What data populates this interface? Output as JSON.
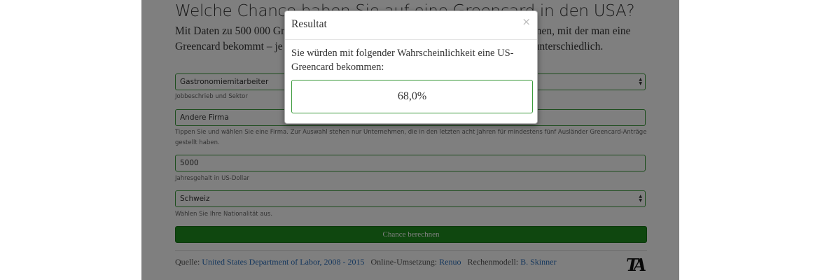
{
  "page": {
    "title": "Welche Chance haben Sie auf eine Greencard in den USA?",
    "intro": "Mit Daten zu 500 000 Greencard-Anträgen lässt sich die Wahrscheinlichkeit errechnen, mit der man eine Greencard bekommt – je nach Job, Anstellungsfirma, Nationalität oder Lohn ganz unterschiedlich."
  },
  "form": {
    "job": {
      "value": "Gastronomiemitarbeiter",
      "help": "Jobbeschrieb und Sektor"
    },
    "company": {
      "value": "Andere Firma",
      "help": "Tippen Sie und wählen Sie eine Firma. Zur Auswahl stehen nur Unternehmen, die in den letzten acht Jahren für mindestens fünf Ausländer Greencard-Anträge gestellt haben."
    },
    "salary": {
      "value": "5000",
      "help": "Jahresgehalt in US-Dollar"
    },
    "nationality": {
      "value": "Schweiz",
      "help": "Wählen Sie Ihre Nationalität aus."
    },
    "submit_label": "Chance berechnen"
  },
  "footer": {
    "source_label": "Quelle:",
    "source_link": "United States Department of Labor, 2008 - 2015",
    "impl_label": "Online-Umsetzung:",
    "impl_link": "Renuo",
    "model_label": "Rechenmodell:",
    "model_link": "B. Skinner",
    "logo_text": "TA"
  },
  "modal": {
    "title": "Resultat",
    "close": "×",
    "text": "Sie würden mit folgender Wahrscheinlichkeit eine US-Greencard bekommen:",
    "result": "68,0%"
  },
  "colors": {
    "overlay": "rgba(0,0,0,0.5)",
    "field_border": "#3c9a3c",
    "button": "#1f8f1f",
    "link": "#2a6ebb"
  },
  "icons": {
    "select_arrows": "select-arrows-icon",
    "close": "close-icon"
  }
}
